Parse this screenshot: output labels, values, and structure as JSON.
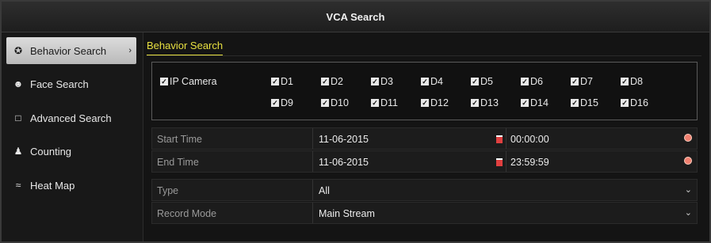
{
  "window": {
    "title": "VCA Search"
  },
  "sidebar": {
    "items": [
      {
        "label": "Behavior Search",
        "icon": "running-person-icon",
        "active": true
      },
      {
        "label": "Face Search",
        "icon": "face-icon",
        "active": false
      },
      {
        "label": "Advanced Search",
        "icon": "scan-icon",
        "active": false
      },
      {
        "label": "Counting",
        "icon": "people-icon",
        "active": false
      },
      {
        "label": "Heat Map",
        "icon": "heatmap-icon",
        "active": false
      }
    ]
  },
  "tab": {
    "label": "Behavior Search"
  },
  "channels": {
    "all_label": "IP Camera",
    "all_checked": true,
    "items": [
      {
        "label": "D1",
        "checked": true
      },
      {
        "label": "D2",
        "checked": true
      },
      {
        "label": "D3",
        "checked": true
      },
      {
        "label": "D4",
        "checked": true
      },
      {
        "label": "D5",
        "checked": true
      },
      {
        "label": "D6",
        "checked": true
      },
      {
        "label": "D7",
        "checked": true
      },
      {
        "label": "D8",
        "checked": true
      },
      {
        "label": "D9",
        "checked": true
      },
      {
        "label": "D10",
        "checked": true
      },
      {
        "label": "D11",
        "checked": true
      },
      {
        "label": "D12",
        "checked": true
      },
      {
        "label": "D13",
        "checked": true
      },
      {
        "label": "D14",
        "checked": true
      },
      {
        "label": "D15",
        "checked": true
      },
      {
        "label": "D16",
        "checked": true
      }
    ]
  },
  "form": {
    "start_time": {
      "label": "Start Time",
      "date": "11-06-2015",
      "time": "00:00:00"
    },
    "end_time": {
      "label": "End Time",
      "date": "11-06-2015",
      "time": "23:59:59"
    },
    "type": {
      "label": "Type",
      "value": "All"
    },
    "record_mode": {
      "label": "Record Mode",
      "value": "Main Stream"
    }
  },
  "colors": {
    "accent": "#e8e040",
    "active_bg": "#cfcfcf",
    "background": "#141414"
  }
}
